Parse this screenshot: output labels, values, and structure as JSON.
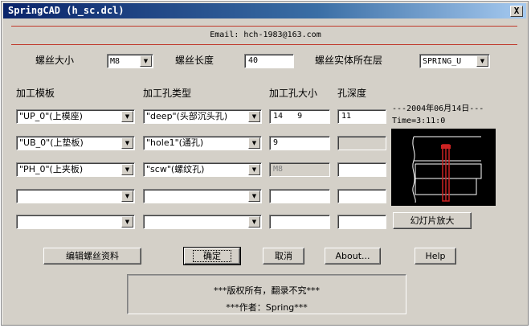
{
  "window": {
    "title": "SpringCAD (h_sc.dcl)",
    "close_glyph": "X"
  },
  "email": "Email: hch-1983@163.com",
  "bolt": {
    "size_label": "螺丝大小",
    "size_value": "M8",
    "length_label": "螺丝长度",
    "length_value": "40",
    "layer_label": "螺丝实体所在层",
    "layer_value": "SPRING_U"
  },
  "columns": {
    "template": "加工模板",
    "hole_type": "加工孔类型",
    "hole_size": "加工孔大小",
    "hole_depth": "孔深度"
  },
  "rows": [
    {
      "template": "\"UP_0\"(上模座)",
      "hole_type": "\"deep\"(头部沉头孔)",
      "size": "14   9",
      "depth": "11"
    },
    {
      "template": "\"UB_0\"(上垫板)",
      "hole_type": "\"hole1\"(通孔)",
      "size": "9",
      "depth": ""
    },
    {
      "template": "\"PH_0\"(上夹板)",
      "hole_type": "\"scw\"(螺纹孔)",
      "size": "M8",
      "depth": ""
    },
    {
      "template": "",
      "hole_type": "",
      "size": "",
      "depth": ""
    },
    {
      "template": "",
      "hole_type": "",
      "size": "",
      "depth": ""
    }
  ],
  "info": {
    "date": "---2004年06月14日---",
    "time": "Time=3:11:0"
  },
  "buttons": {
    "slide_zoom": "幻灯片放大",
    "edit_bolt": "编辑螺丝资料",
    "ok": "确定",
    "cancel": "取消",
    "about": "About...",
    "help": "Help"
  },
  "copyright": {
    "line1": "***版权所有，翻录不究***",
    "line2": "***作者：Spring***"
  },
  "colors": {
    "accent_line": "#c0392b",
    "bolt_red": "#cc2222",
    "preview_bg": "#000000"
  }
}
